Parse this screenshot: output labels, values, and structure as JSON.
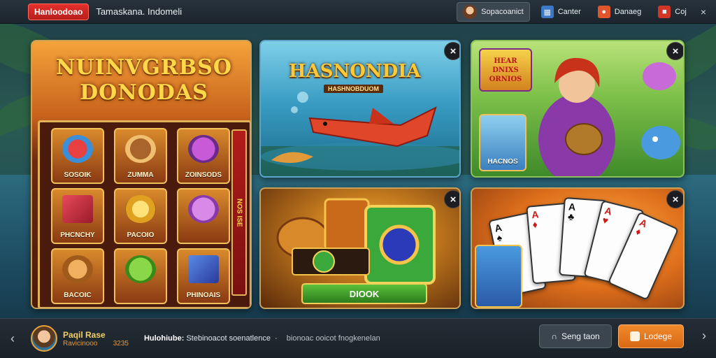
{
  "header": {
    "brand": "Hanloodoao",
    "breadcrumb": "Tamaskana.  Indomeli",
    "profile_label": "Sopacoanict",
    "center_label": "Canter",
    "danaeg_label": "Danaeg",
    "coj_label": "Coj",
    "close_glyph": "×"
  },
  "tiles": {
    "slot": {
      "title_line1": "NUINVGRBSO",
      "title_line2": "DONODAS",
      "symbols": [
        "SOSOIK",
        "ZUMMA",
        "ZOINSODS",
        "PHCNCHY",
        "PACOIO",
        "",
        "BACOIC",
        "",
        "PHINOAIS"
      ],
      "side_label": "NOS ISE"
    },
    "fish": {
      "title": "HASNONDIA",
      "subtitle": "HASHNOBDUOM"
    },
    "lady": {
      "logo_lines": [
        "HEAR",
        "DNIXS",
        "ORNIOS"
      ],
      "minicard_label": "HACNOS"
    },
    "treasure": {
      "button_label": "DIOOK"
    }
  },
  "bottom": {
    "prev_glyph": "‹",
    "next_glyph": "›",
    "username": "Paqil Rase",
    "user_sub": "Ravicinooo        3235",
    "ticker_bold": "Hulohiube:",
    "ticker_text": "Stebinoacot soenatlence  ·",
    "ticker_dim": "bionoac ooicot fnogkenelan",
    "song_button": "Seng taon",
    "lodge_button": "Lodege"
  },
  "colors": {
    "accent_red": "#e4302b",
    "accent_orange": "#f08a2c",
    "gold": "#ffd74a"
  }
}
